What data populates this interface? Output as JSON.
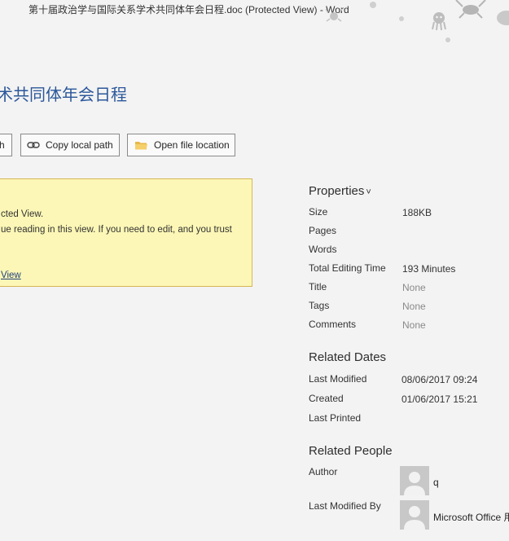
{
  "window": {
    "title": "第十届政治学与国际关系学术共同体年会日程.doc (Protected View)  -  Word"
  },
  "document": {
    "title_partial": "术共同体年会日程"
  },
  "actions": {
    "cut_button_label": "h",
    "copy_path_label": "Copy local path",
    "open_location_label": "Open file location"
  },
  "warning": {
    "line1": "cted View.",
    "line2": "ue reading in this view. If you need to edit, and you trust",
    "link": "View"
  },
  "properties": {
    "heading": "Properties",
    "heading_chevron": "˅",
    "rows": [
      {
        "label": "Size",
        "value": "188KB",
        "muted": false
      },
      {
        "label": "Pages",
        "value": "",
        "muted": false
      },
      {
        "label": "Words",
        "value": "",
        "muted": false
      },
      {
        "label": "Total Editing Time",
        "value": "193 Minutes",
        "muted": false
      },
      {
        "label": "Title",
        "value": "None",
        "muted": true
      },
      {
        "label": "Tags",
        "value": "None",
        "muted": true
      },
      {
        "label": "Comments",
        "value": "None",
        "muted": true
      }
    ]
  },
  "related_dates": {
    "heading": "Related Dates",
    "rows": [
      {
        "label": "Last Modified",
        "value": "08/06/2017 09:24"
      },
      {
        "label": "Created",
        "value": "01/06/2017 15:21"
      },
      {
        "label": "Last Printed",
        "value": ""
      }
    ]
  },
  "related_people": {
    "heading": "Related People",
    "author_label": "Author",
    "author_name": "q",
    "last_modified_by_label": "Last Modified By",
    "last_modified_by_name": "Microsoft Office 用"
  },
  "colors": {
    "accent": "#2b579a",
    "warning_bg": "#fcf7b6",
    "warning_border": "#d6b656"
  }
}
